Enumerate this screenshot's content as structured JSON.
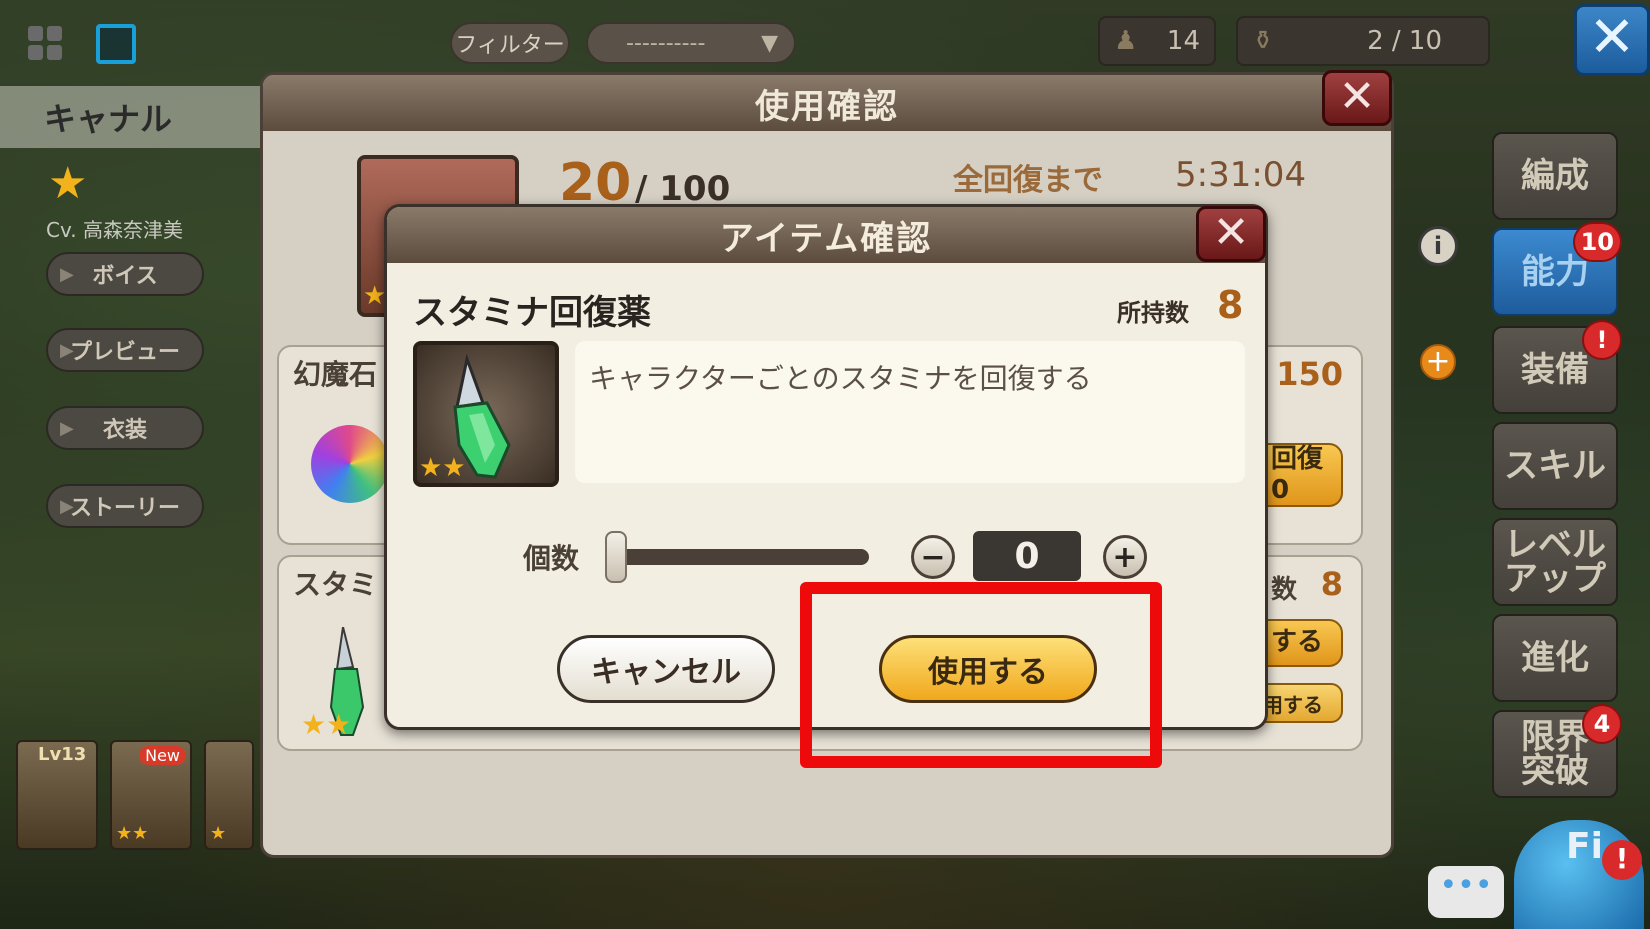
{
  "topbar": {
    "filter_label": "フィルター",
    "select_value": "----------",
    "stat_a_value": "14",
    "stat_b_value": "2 / 10"
  },
  "left_panel": {
    "character_name": "キャナル",
    "cv": "Cv. 高森奈津美",
    "buttons": [
      "ボイス",
      "プレビュー",
      "衣装",
      "ストーリー"
    ],
    "thumbs": [
      {
        "lv": "Lv13",
        "stars": ""
      },
      {
        "new": "New",
        "stars": "★★"
      },
      {
        "stars": "★"
      }
    ]
  },
  "right_menu": {
    "items": [
      {
        "label": "編成"
      },
      {
        "label": "能力",
        "badge": "10"
      },
      {
        "label": "装備",
        "badge": "!"
      },
      {
        "label": "スキル"
      },
      {
        "label": "レベル\nアップ"
      },
      {
        "label": "進化"
      },
      {
        "label": "限界\n突破",
        "badge": "4"
      }
    ],
    "mascot_text": "Fi",
    "mascot_alert": "!",
    "chat_dots": "•••"
  },
  "outer_dialog": {
    "title": "使用確認",
    "stamina_current": "20",
    "stamina_max": "/ 100",
    "recover_label": "全回復まで",
    "recover_time": "5:31:04",
    "card1": {
      "title": "幻魔石",
      "right_num": "150",
      "button": "回復\n0"
    },
    "card2": {
      "title": "スタミ",
      "owned_label": "数",
      "owned_val": "8",
      "button": "する",
      "button2": "連続で使用する"
    }
  },
  "item_dialog": {
    "title": "アイテム確認",
    "item_name": "スタミナ回復薬",
    "owned_label": "所持数",
    "owned_value": "8",
    "description": "キャラクターごとのスタミナを回復する",
    "icon_stars": "★★",
    "quantity_label": "個数",
    "quantity_value": "0",
    "quantity_fraction": 0,
    "minus": "−",
    "plus": "+",
    "cancel_label": "キャンセル",
    "use_label": "使用する"
  },
  "colors": {
    "highlight": "#ee0a0a",
    "accent_gold": "#f0a81c",
    "stamina_orange": "#a8601a"
  }
}
